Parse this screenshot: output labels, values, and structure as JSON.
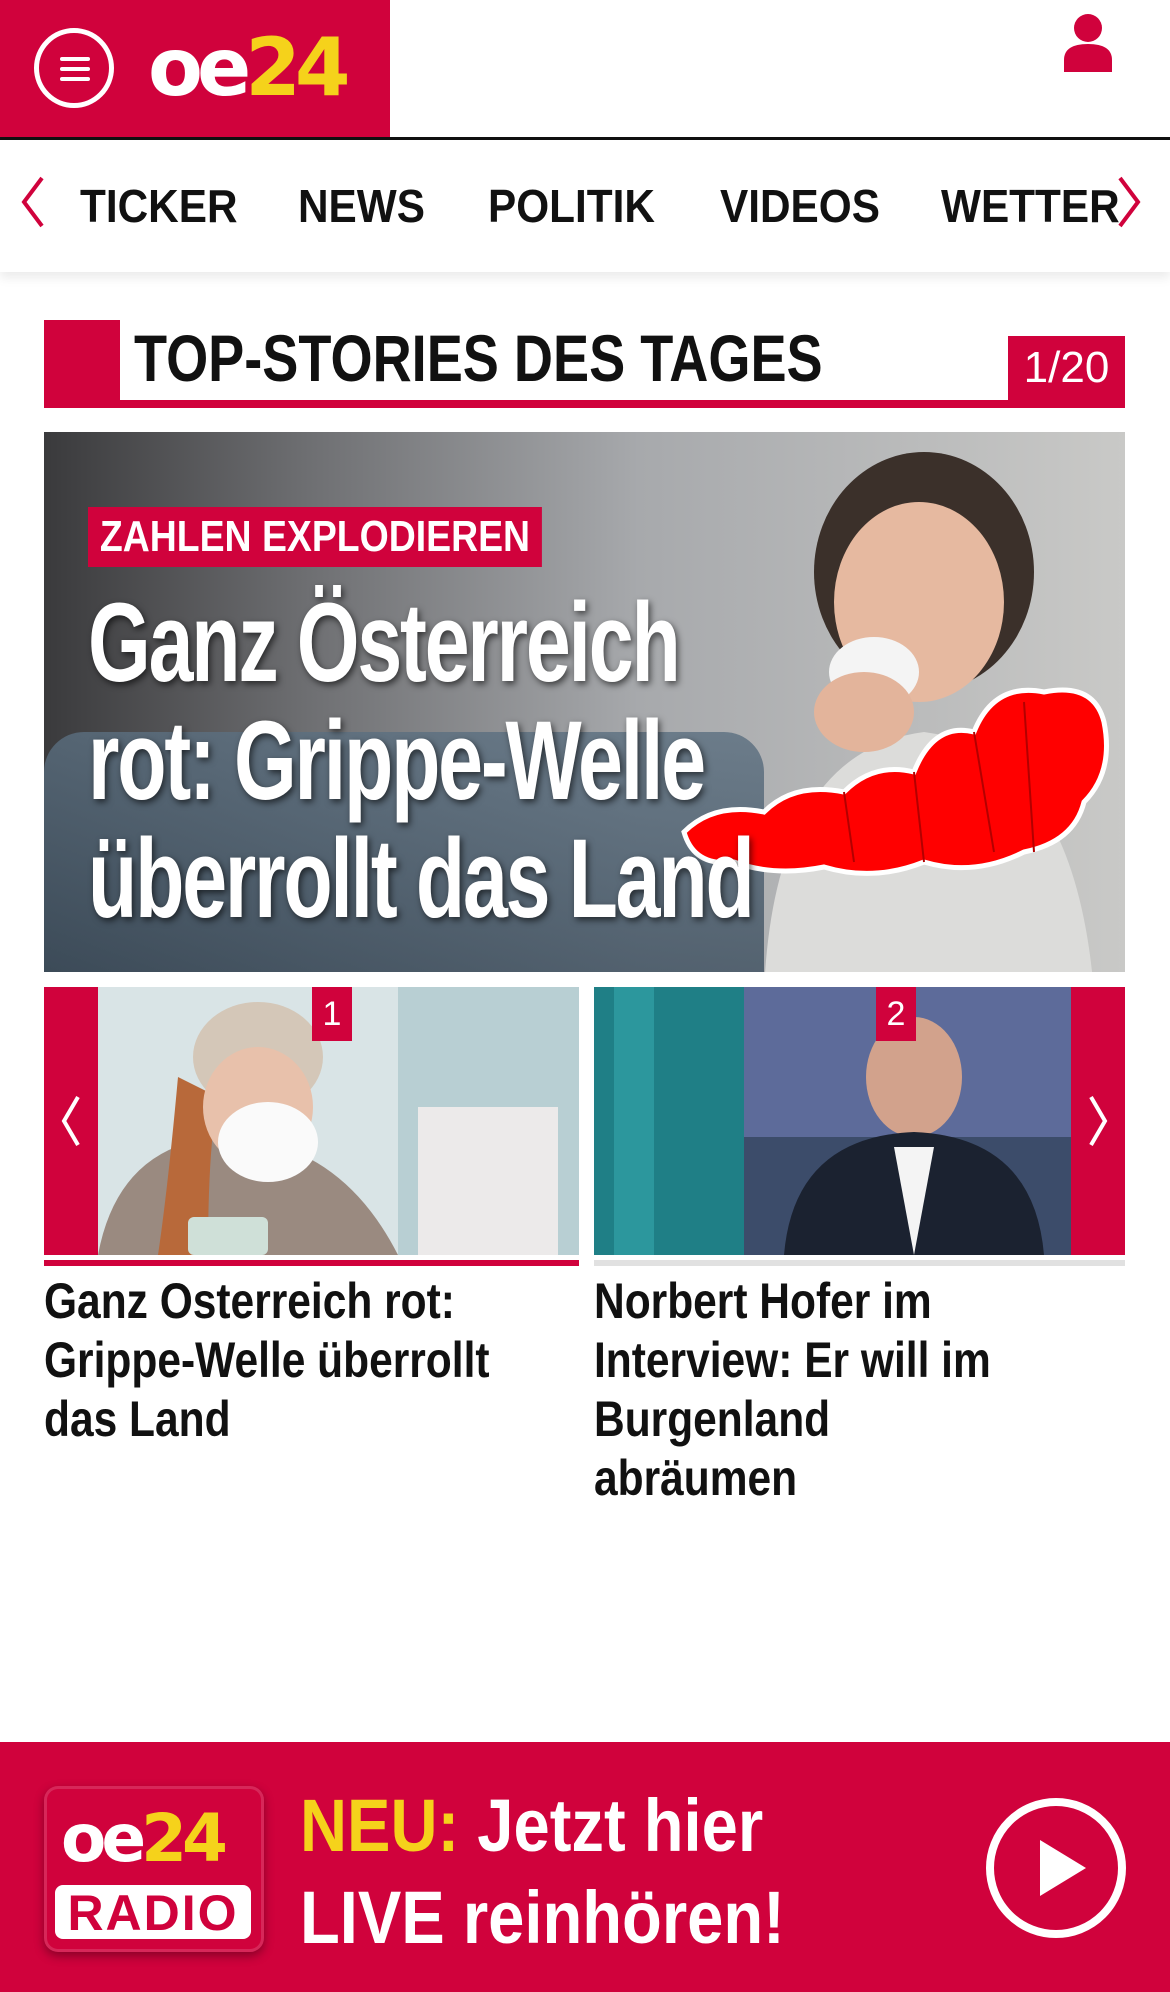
{
  "header": {
    "logo_text_white": "oe",
    "logo_text_yellow": "24",
    "menu_icon": "hamburger-icon",
    "user_icon": "user-icon"
  },
  "nav": {
    "items": [
      "TICKER",
      "NEWS",
      "POLITIK",
      "VIDEOS",
      "WETTER"
    ],
    "prev_icon": "chevron-left-icon",
    "next_icon": "chevron-right-icon"
  },
  "section": {
    "title": "TOP-STORIES DES TAGES",
    "pager": "1/20"
  },
  "hero": {
    "kicker": "ZAHLEN EXPLODIEREN",
    "headline_line1": "Ganz Österreich",
    "headline_line2": "rot: Grippe-Welle",
    "headline_line3": "überrollt das Land"
  },
  "teasers": [
    {
      "number": "1",
      "title": "Ganz Osterreich rot: Grippe-Welle überrollt das Land"
    },
    {
      "number": "2",
      "title": "Norbert Hofer im Interview: Er will im Burgenland abräumen"
    }
  ],
  "radio_banner": {
    "logo_white": "oe",
    "logo_yellow": "24",
    "logo_label": "RADIO",
    "neu": "NEU:",
    "line1_rest": " Jetzt hier",
    "line2": "LIVE reinhören!",
    "play_icon": "play-icon"
  },
  "colors": {
    "brand_red": "#d0023c",
    "brand_yellow": "#f5d21b"
  }
}
